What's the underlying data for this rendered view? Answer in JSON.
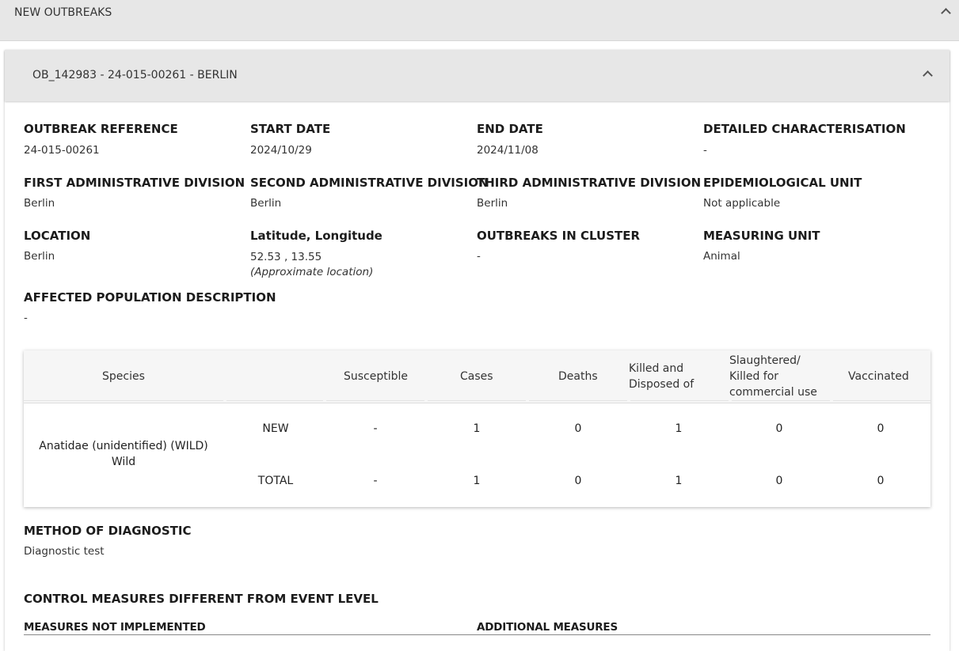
{
  "section": {
    "title": "NEW OUTBREAKS"
  },
  "outbreak": {
    "title": "OB_142983 - 24-015-00261 - BERLIN",
    "fields": {
      "outbreak_reference": {
        "label": "OUTBREAK REFERENCE",
        "value": "24-015-00261"
      },
      "start_date": {
        "label": "START DATE",
        "value": "2024/10/29"
      },
      "end_date": {
        "label": "END DATE",
        "value": "2024/11/08"
      },
      "detailed_characterisation": {
        "label": "DETAILED CHARACTERISATION",
        "value": "-"
      },
      "first_admin": {
        "label": "FIRST ADMINISTRATIVE DIVISION",
        "value": "Berlin"
      },
      "second_admin": {
        "label": "SECOND ADMINISTRATIVE DIVISION",
        "value": "Berlin"
      },
      "third_admin": {
        "label": "THIRD ADMINISTRATIVE DIVISION",
        "value": "Berlin"
      },
      "epi_unit": {
        "label": "EPIDEMIOLOGICAL UNIT",
        "value": "Not applicable"
      },
      "location": {
        "label": "LOCATION",
        "value": "Berlin"
      },
      "latlon": {
        "label": "Latitude, Longitude",
        "value": "52.53 , 13.55",
        "note": "(Approximate location)"
      },
      "outbreaks_in_cluster": {
        "label": "OUTBREAKS IN CLUSTER",
        "value": "-"
      },
      "measuring_unit": {
        "label": "MEASURING UNIT",
        "value": "Animal"
      },
      "affected_population": {
        "label": "AFFECTED POPULATION DESCRIPTION",
        "value": "-"
      }
    },
    "table": {
      "headers": {
        "species": "Species",
        "susceptible": "Susceptible",
        "cases": "Cases",
        "deaths": "Deaths",
        "killed_line1": "Killed and",
        "killed_line2": "Disposed of",
        "slaughtered_line1": "Slaughtered/",
        "slaughtered_line2": "Killed for",
        "slaughtered_line3": "commercial use",
        "vaccinated": "Vaccinated"
      },
      "species_name": "Anatidae (unidentified) (WILD)",
      "species_type": "Wild",
      "rows": [
        {
          "label": "NEW",
          "susceptible": "-",
          "cases": "1",
          "deaths": "0",
          "killed": "1",
          "slaughtered": "0",
          "vaccinated": "0"
        },
        {
          "label": "TOTAL",
          "susceptible": "-",
          "cases": "1",
          "deaths": "0",
          "killed": "1",
          "slaughtered": "0",
          "vaccinated": "0"
        }
      ]
    },
    "diagnostic": {
      "label": "METHOD OF DIAGNOSTIC",
      "value": "Diagnostic test"
    },
    "control_measures": {
      "title": "CONTROL MEASURES DIFFERENT FROM EVENT LEVEL",
      "not_implemented_label": "MEASURES NOT IMPLEMENTED",
      "additional_label": "ADDITIONAL MEASURES"
    }
  }
}
